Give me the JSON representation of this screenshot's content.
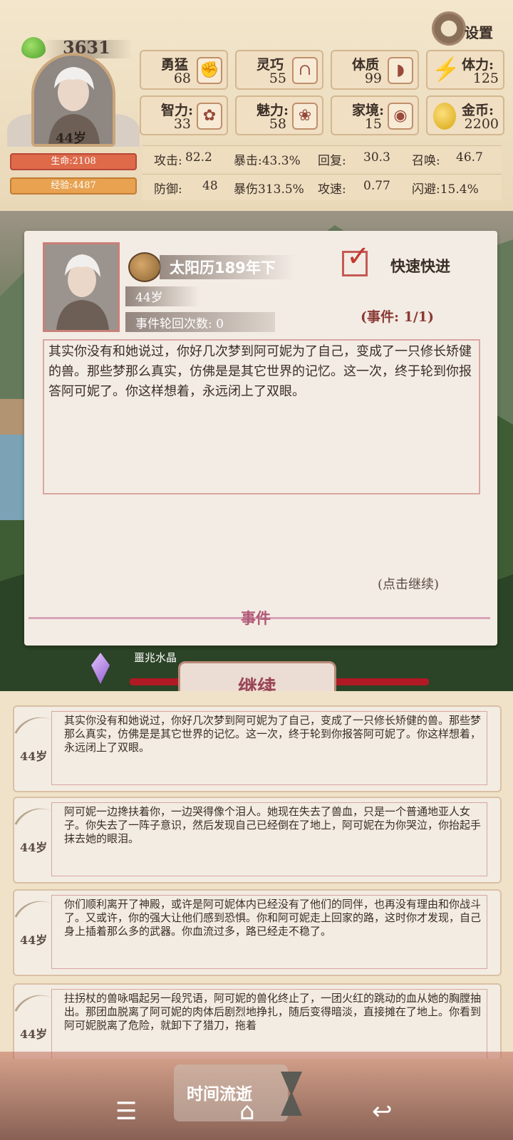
{
  "player": {
    "score": "3631",
    "age": "44岁",
    "hp_label": "生命:2108",
    "exp_label": "经验:4487"
  },
  "settings": {
    "label": "设置"
  },
  "attributes": [
    {
      "label": "勇猛",
      "value": "68",
      "icon": "fist-icon"
    },
    {
      "label": "灵巧",
      "value": "55",
      "icon": "legs-icon"
    },
    {
      "label": "体质",
      "value": "99",
      "icon": "muscle-arm-icon"
    },
    {
      "label": "智力:",
      "value": "33",
      "icon": "brain-icon"
    },
    {
      "label": "魅力:",
      "value": "58",
      "icon": "lotus-icon"
    },
    {
      "label": "家境:",
      "value": "15",
      "icon": "coin-hand-icon"
    }
  ],
  "resources": {
    "stamina": {
      "label": "体力:",
      "value": "125",
      "icon": "lightning-icon"
    },
    "gold": {
      "label": "金币:",
      "value": "2200",
      "icon": "gold-coin-icon"
    }
  },
  "combat": [
    {
      "label": "攻击:",
      "value": "82.2"
    },
    {
      "label": "暴击:43.3%",
      "value": ""
    },
    {
      "label": "回复:",
      "value": "30.3"
    },
    {
      "label": "召唤:",
      "value": "46.7"
    },
    {
      "label": "防御:",
      "value": "48"
    },
    {
      "label": "暴伤313.5%",
      "value": ""
    },
    {
      "label": "攻速:",
      "value": "0.77"
    },
    {
      "label": "闪避:15.4%",
      "value": ""
    }
  ],
  "event": {
    "date": "太阳历189年下",
    "age": "44岁",
    "cycle": "事件轮回次数: 0",
    "fast_forward": "快速快进",
    "count": "(事件: 1/1)",
    "text": "其实你没有和她说过，你好几次梦到阿可妮为了自己，变成了一只修长矫健的兽。那些梦那么真实，仿佛是是其它世界的记忆。这一次，终于轮到你报答阿可妮了。你这样想着，永远闭上了双眼。",
    "tap_continue": "(点击继续)",
    "footer": "事件"
  },
  "crystal": {
    "label": "噩兆水晶"
  },
  "continue_button": "继续",
  "log": [
    {
      "age": "44岁",
      "text": "其实你没有和她说过，你好几次梦到阿可妮为了自己，变成了一只修长矫健的兽。那些梦那么真实，仿佛是是其它世界的记忆。这一次，终于轮到你报答阿可妮了。你这样想着，永远闭上了双眼。"
    },
    {
      "age": "44岁",
      "text": "阿可妮一边搀扶着你，一边哭得像个泪人。她现在失去了兽血，只是一个普通地亚人女子。你失去了一阵子意识，然后发现自己已经倒在了地上，阿可妮在为你哭泣，你抬起手抹去她的眼泪。"
    },
    {
      "age": "44岁",
      "text": "你们顺利离开了神殿，或许是阿可妮体内已经没有了他们的同伴，也再没有理由和你战斗了。又或许，你的强大让他们感到恐惧。你和阿可妮走上回家的路，这时你才发现，自己身上插着那么多的武器。你血流过多，路已经走不稳了。"
    },
    {
      "age": "44岁",
      "text": "拄拐杖的兽咏唱起另一段咒语，阿可妮的兽化终止了，一团火红的跳动的血从她的胸膛抽出。那团血脱离了阿可妮的肉体后剧烈地挣扎，随后变得暗淡，直接摊在了地上。你看到阿可妮脱离了危险，就卸下了猎刀，拖着"
    }
  ],
  "time_pass": "时间流逝",
  "nav": {
    "menu": "☰",
    "home": "⌂",
    "back": "↩"
  }
}
